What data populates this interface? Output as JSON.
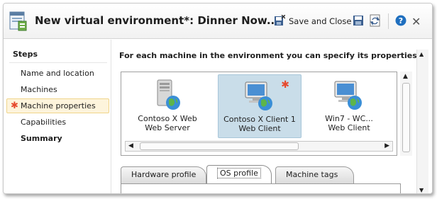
{
  "window": {
    "title": "New virtual environment*: Dinner Now...",
    "app_icon": "environment-icon",
    "toolbar": {
      "save_close_label": "Save and Close",
      "save_close_icon": "save-close-icon",
      "save_icon": "save-icon",
      "refresh_icon": "refresh-icon",
      "help_icon": "help-icon",
      "close_glyph": "✕"
    }
  },
  "steps": {
    "header": "Steps",
    "items": [
      {
        "label": "Name and location",
        "active": false,
        "required": false,
        "bold": false
      },
      {
        "label": "Machines",
        "active": false,
        "required": false,
        "bold": false
      },
      {
        "label": "Machine properties",
        "active": true,
        "required": true,
        "bold": false
      },
      {
        "label": "Capabilities",
        "active": false,
        "required": false,
        "bold": false
      },
      {
        "label": "Summary",
        "active": false,
        "required": false,
        "bold": true
      }
    ],
    "required_marker": "✱"
  },
  "content": {
    "instructions": "For each machine in the environment you can specify its properties.",
    "machines": [
      {
        "line1": "Contoso X Web",
        "line2": "Web Server",
        "icon": "server-icon",
        "selected": false
      },
      {
        "line1": "Contoso X Client 1",
        "line2": "Web Client",
        "icon": "client-computer-icon",
        "selected": true,
        "required": true
      },
      {
        "line1": "Win7 - WC...",
        "line2": "Web Client",
        "icon": "client-computer-icon",
        "selected": false
      }
    ],
    "tabs": [
      {
        "label": "Hardware profile",
        "active": false
      },
      {
        "label": "OS profile",
        "active": true
      },
      {
        "label": "Machine tags",
        "active": false
      }
    ]
  },
  "colors": {
    "accent_selected": "#c9dde9",
    "step_active_bg": "#fdf4dc",
    "required_star": "#e64a2e",
    "help_blue": "#1f6fbf"
  }
}
